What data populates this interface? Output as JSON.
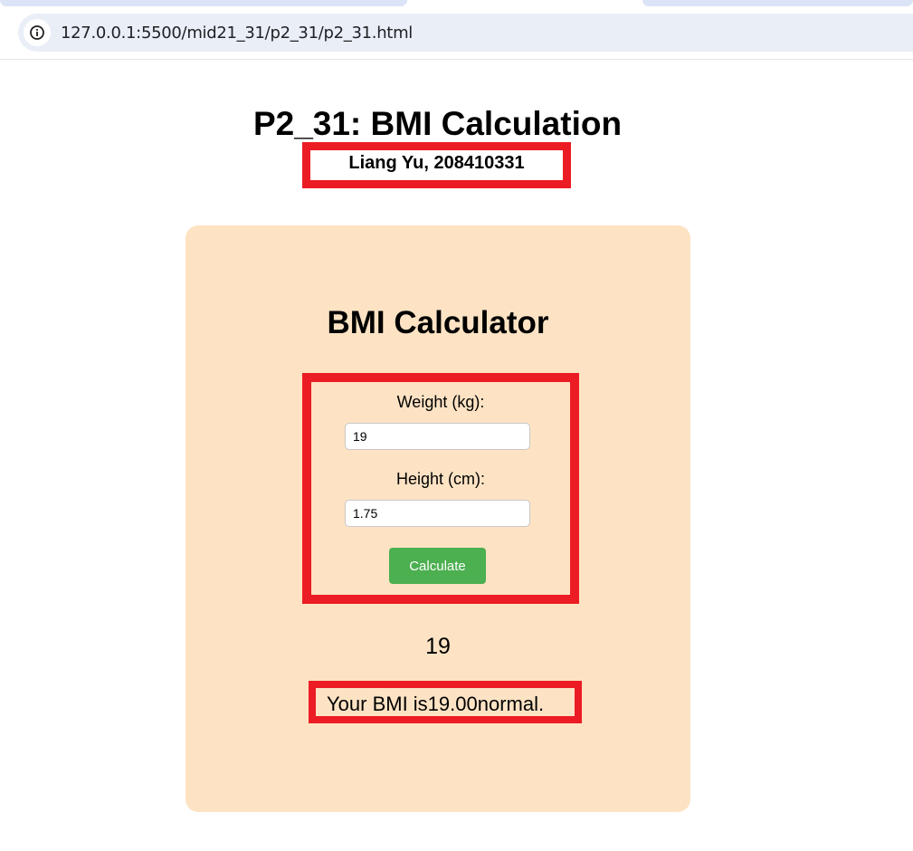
{
  "browser": {
    "url": "127.0.0.1:5500/mid21_31/p2_31/p2_31.html"
  },
  "page": {
    "title": "P2_31: BMI Calculation",
    "author": "Liang Yu, 208410331"
  },
  "calculator": {
    "heading": "BMI Calculator",
    "weight_label": "Weight (kg):",
    "weight_value": "19",
    "height_label": "Height (cm):",
    "height_value": "1.75",
    "button_label": "Calculate",
    "weight_echo": "19",
    "result_text": "Your BMI is19.00normal."
  },
  "colors": {
    "card_background": "#fde3c4",
    "button": "#4caf50",
    "annotation_border": "#ec1c24"
  }
}
